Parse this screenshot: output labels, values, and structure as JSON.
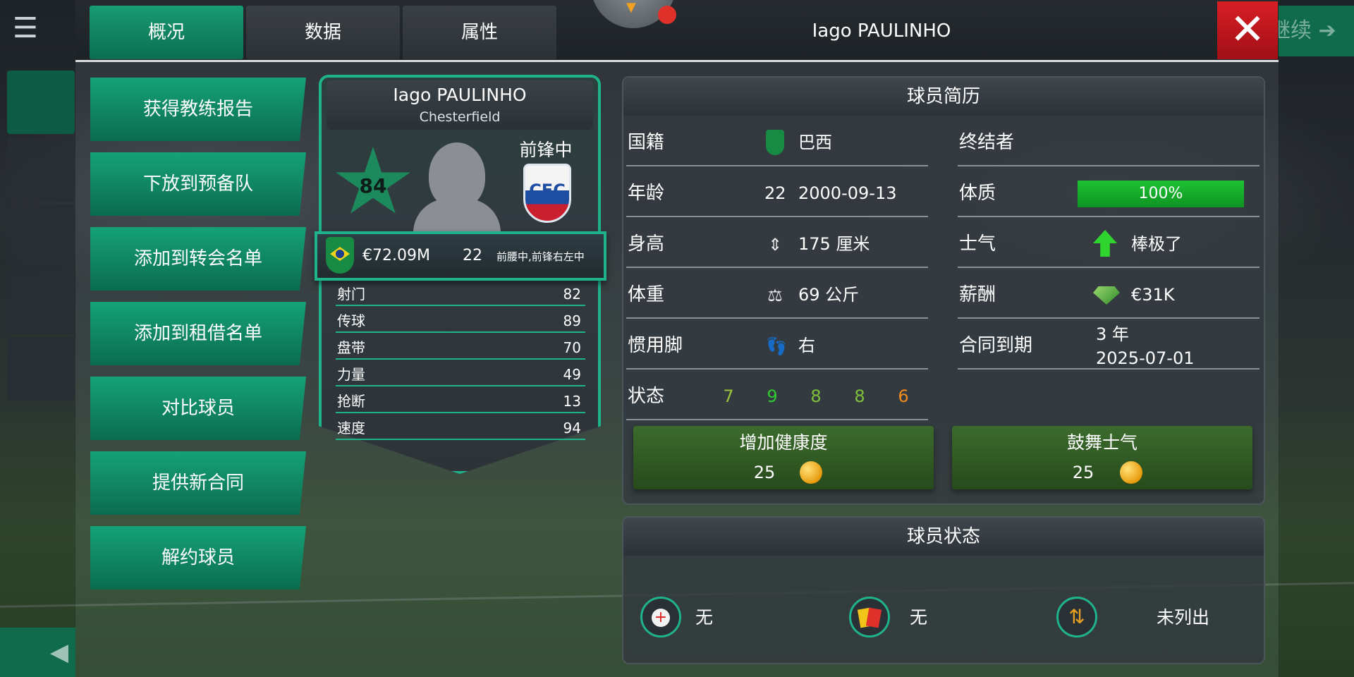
{
  "tabs": [
    "概况",
    "数据",
    "属性"
  ],
  "header": {
    "title": "Iago PAULINHO",
    "close_icon": "close-icon"
  },
  "background_ui": {
    "continue_label": "继续",
    "menu_icon": "menu-icon",
    "back_icon": "back-arrow-icon"
  },
  "actions": [
    "获得教练报告",
    "下放到预备队",
    "添加到转会名单",
    "添加到租借名单",
    "对比球员",
    "提供新合同",
    "解约球员"
  ],
  "card": {
    "name": "Iago PAULINHO",
    "club": "Chesterfield",
    "rating": "84",
    "position": "前锋中",
    "crest_text": "CFC",
    "value": "€72.09M",
    "age": "22",
    "positions": "前腰中,前锋右左中",
    "attributes": [
      {
        "name": "射门",
        "value": "82"
      },
      {
        "name": "传球",
        "value": "89"
      },
      {
        "name": "盘带",
        "value": "70"
      },
      {
        "name": "力量",
        "value": "49"
      },
      {
        "name": "抢断",
        "value": "13"
      },
      {
        "name": "速度",
        "value": "94"
      }
    ]
  },
  "profile": {
    "title": "球员简历",
    "nationality_label": "国籍",
    "nationality": "巴西",
    "age_label": "年龄",
    "age": "22",
    "dob": "2000-09-13",
    "height_label": "身高",
    "height": "175 厘米",
    "weight_label": "体重",
    "weight": "69 公斤",
    "foot_label": "惯用脚",
    "foot": "右",
    "form_label": "状态",
    "form": [
      {
        "value": "7",
        "color": "#9ac43a"
      },
      {
        "value": "9",
        "color": "#32c832"
      },
      {
        "value": "8",
        "color": "#7fc03a"
      },
      {
        "value": "8",
        "color": "#7fc03a"
      },
      {
        "value": "6",
        "color": "#f08a1e"
      }
    ],
    "role": "终结者",
    "fitness_label": "体质",
    "fitness": "100%",
    "fitness_fraction": 1.0,
    "morale_label": "士气",
    "morale": "棒极了",
    "wage_label": "薪酬",
    "wage": "€31K",
    "contract_label": "合同到期",
    "contract_years": "3 年",
    "contract_date": "2025-07-01",
    "boost_fitness": {
      "label": "增加健康度",
      "cost": "25"
    },
    "boost_morale": {
      "label": "鼓舞士气",
      "cost": "25"
    }
  },
  "status": {
    "title": "球员状态",
    "injury": "无",
    "cards": "无",
    "listing": "未列出"
  },
  "colors": {
    "accent_green": "#15a276",
    "close_red": "#d81e25",
    "card_border": "#1fb38c"
  }
}
